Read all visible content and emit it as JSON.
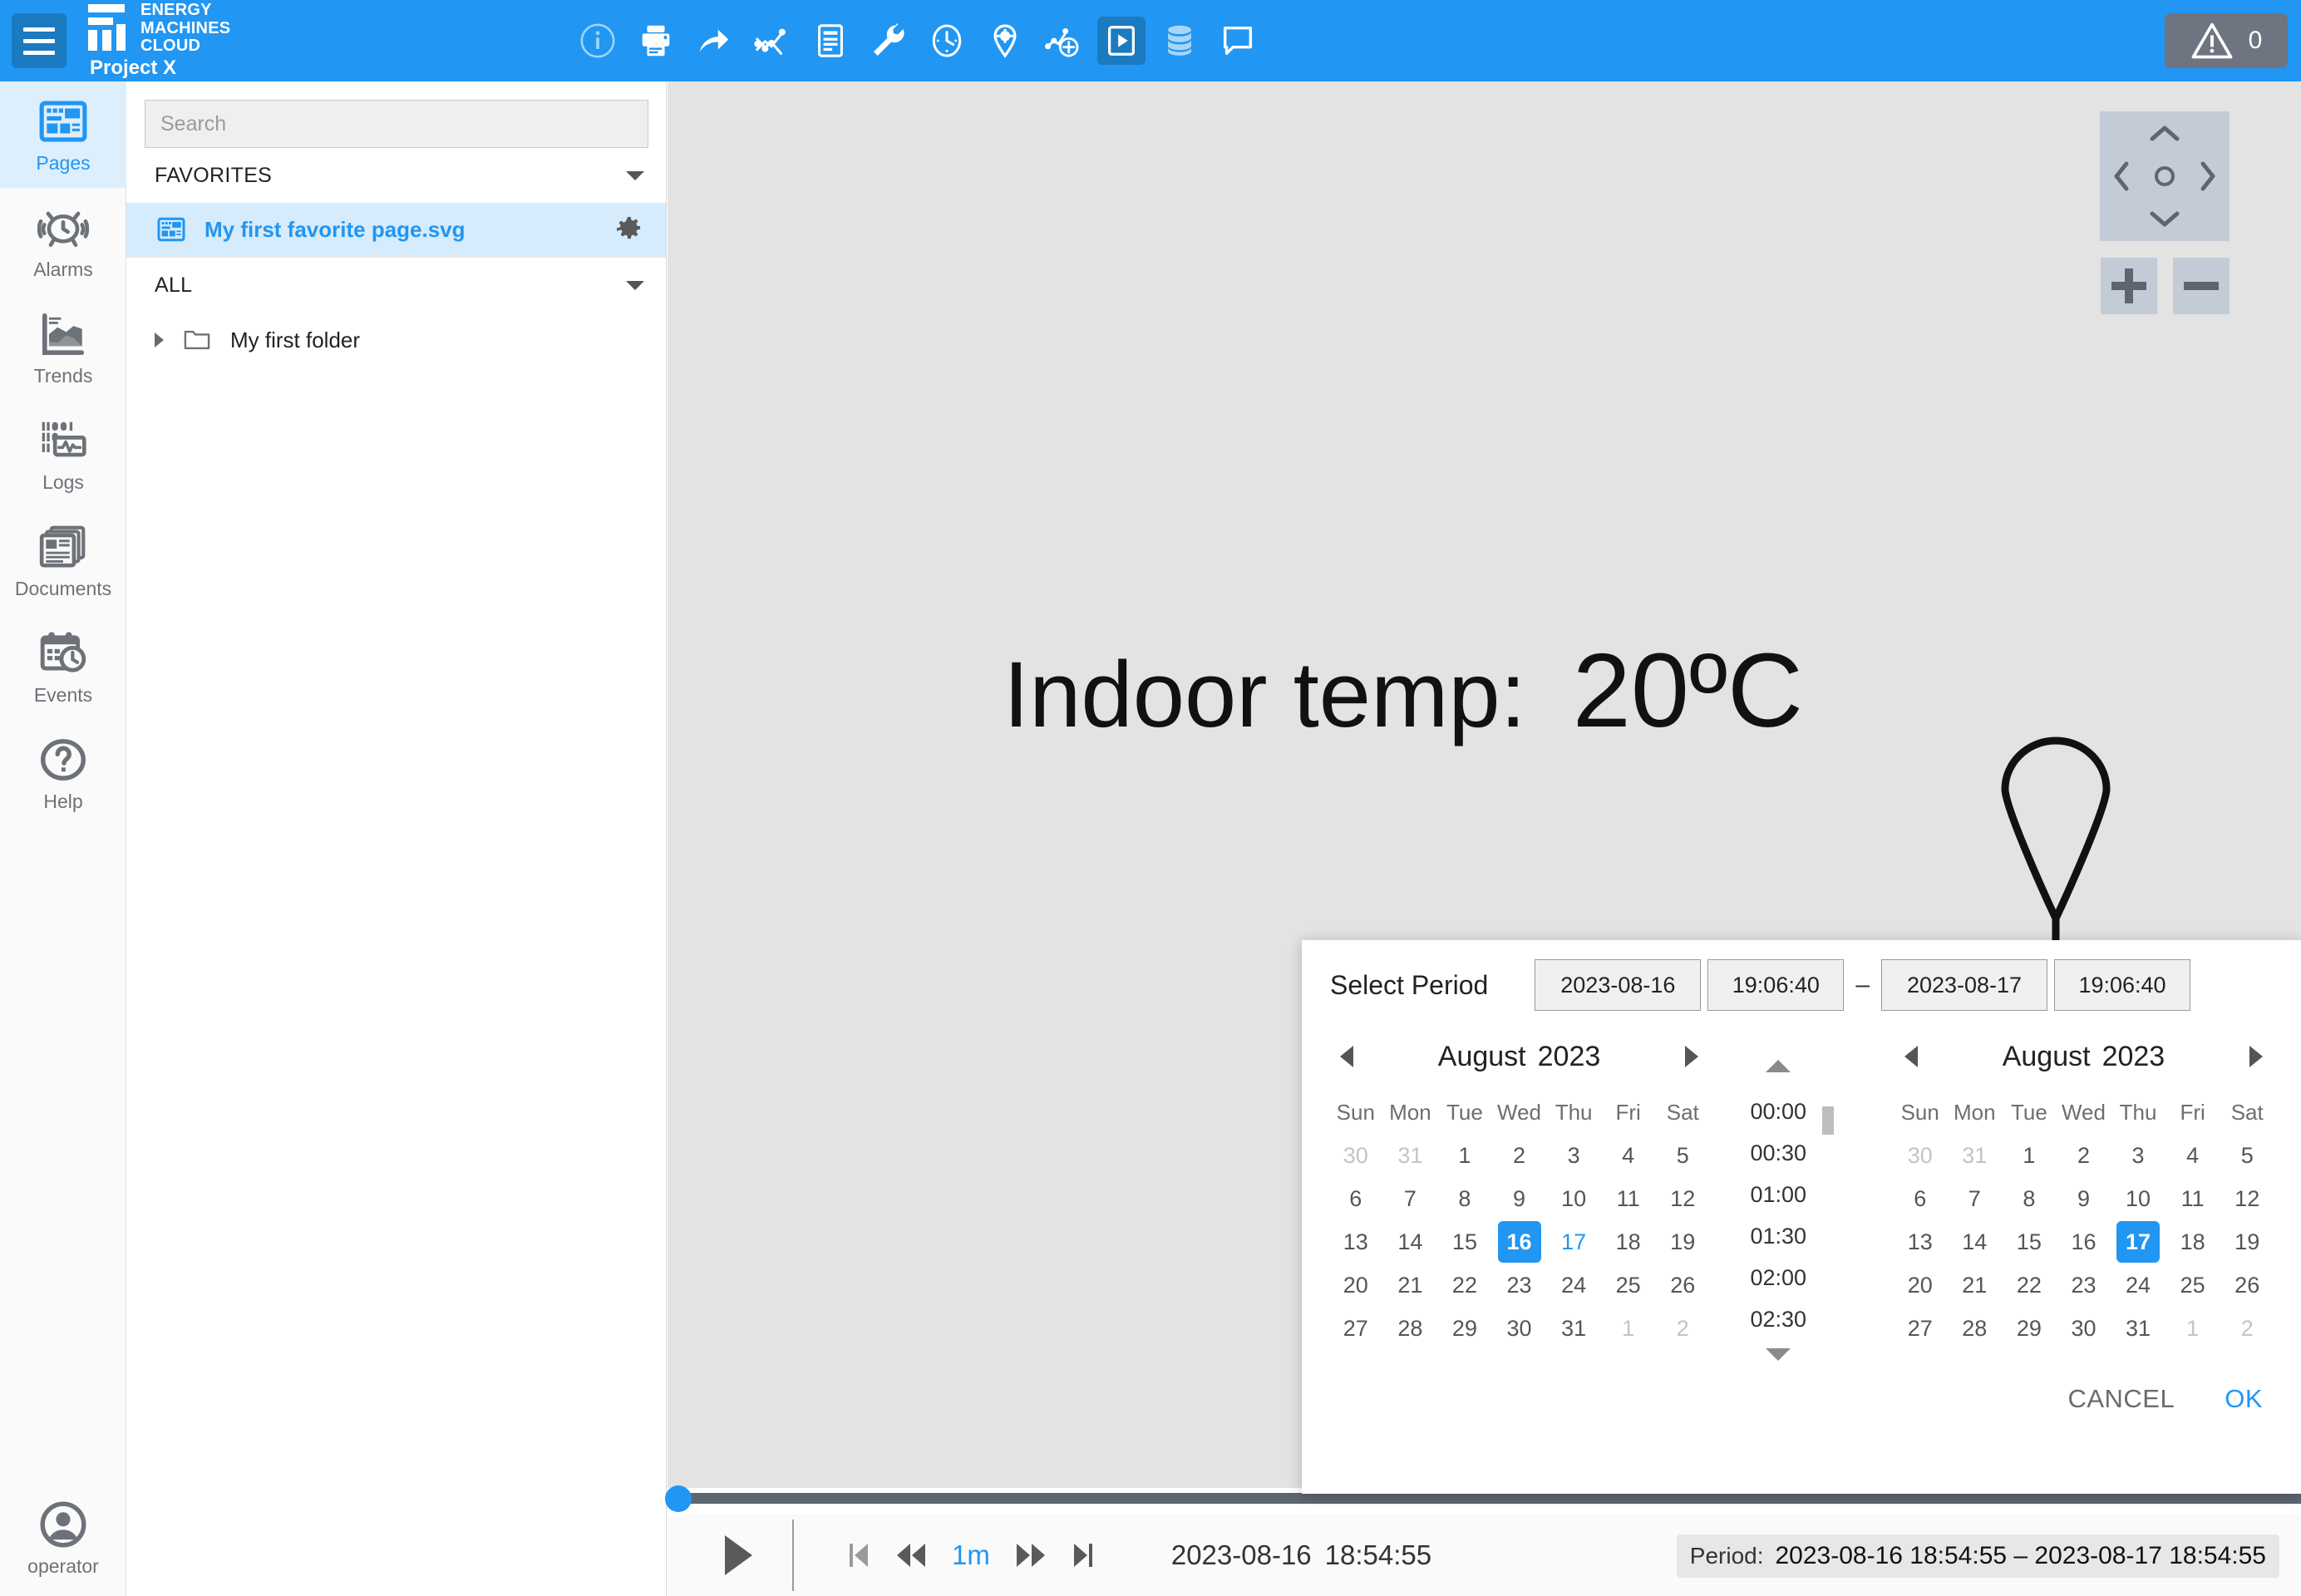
{
  "header": {
    "brand_lines": [
      "ENERGY",
      "MACHINES",
      "CLOUD"
    ],
    "project": "Project X",
    "menu_icon": "hamburger-icon",
    "toolbar": [
      {
        "name": "info-icon",
        "label": "Info",
        "active": false
      },
      {
        "name": "print-icon",
        "label": "Print",
        "active": false
      },
      {
        "name": "share-icon",
        "label": "Share",
        "active": false
      },
      {
        "name": "trend-icon",
        "label": "Trend",
        "active": false
      },
      {
        "name": "report-icon",
        "label": "Report",
        "active": false
      },
      {
        "name": "wrench-icon",
        "label": "Service",
        "active": false
      },
      {
        "name": "clock-icon",
        "label": "Schedule",
        "active": false
      },
      {
        "name": "settings-point-icon",
        "label": "Settings",
        "active": false
      },
      {
        "name": "add-point-icon",
        "label": "Add point",
        "active": false
      },
      {
        "name": "play-panel-icon",
        "label": "Playback",
        "active": true
      },
      {
        "name": "database-icon",
        "label": "Database",
        "active": false
      },
      {
        "name": "comment-icon",
        "label": "Comments",
        "active": false
      }
    ],
    "alarm": {
      "icon": "warning-triangle-icon",
      "count": "0"
    }
  },
  "sidebar": {
    "items": [
      {
        "label": "Pages",
        "icon": "pages-icon",
        "active": true
      },
      {
        "label": "Alarms",
        "icon": "alarm-clock-icon",
        "active": false
      },
      {
        "label": "Trends",
        "icon": "trends-chart-icon",
        "active": false
      },
      {
        "label": "Logs",
        "icon": "logs-icon",
        "active": false
      },
      {
        "label": "Documents",
        "icon": "documents-icon",
        "active": false
      },
      {
        "label": "Events",
        "icon": "events-calendar-icon",
        "active": false
      },
      {
        "label": "Help",
        "icon": "help-question-icon",
        "active": false
      }
    ],
    "user": {
      "label": "operator",
      "icon": "account-circle-icon"
    }
  },
  "tree": {
    "search_placeholder": "Search",
    "search_value": "",
    "favorites_header": "FAVORITES",
    "favorite_item": {
      "label": "My first favorite page.svg",
      "icon": "page-icon",
      "settings_icon": "gear-icon"
    },
    "all_header": "ALL",
    "folder_item": {
      "label": "My first folder",
      "icon": "folder-icon"
    }
  },
  "canvas": {
    "label": "Indoor temp:",
    "value": "20ºC",
    "symbol": "temperature-sensor-pin",
    "pan_control": {
      "up": "chevron-up-icon",
      "down": "chevron-down-icon",
      "left": "chevron-left-icon",
      "right": "chevron-right-icon",
      "center": "circle-reset-icon"
    },
    "zoom_in": "plus-icon",
    "zoom_out": "minus-icon"
  },
  "dialog": {
    "title": "Select Period",
    "start_date": "2023-08-16",
    "start_time": "19:06:40",
    "separator": "–",
    "end_date": "2023-08-17",
    "end_time": "19:06:40",
    "cancel_label": "CANCEL",
    "ok_label": "OK",
    "time_list": [
      "00:00",
      "00:30",
      "01:00",
      "01:30",
      "02:00",
      "02:30"
    ],
    "left_calendar": {
      "month": "August",
      "year": "2023",
      "dow": [
        "Sun",
        "Mon",
        "Tue",
        "Wed",
        "Thu",
        "Fri",
        "Sat"
      ],
      "weeks": [
        [
          {
            "d": "30",
            "s": "muted"
          },
          {
            "d": "31",
            "s": "muted"
          },
          {
            "d": "1",
            "s": ""
          },
          {
            "d": "2",
            "s": ""
          },
          {
            "d": "3",
            "s": ""
          },
          {
            "d": "4",
            "s": ""
          },
          {
            "d": "5",
            "s": ""
          }
        ],
        [
          {
            "d": "6",
            "s": ""
          },
          {
            "d": "7",
            "s": ""
          },
          {
            "d": "8",
            "s": ""
          },
          {
            "d": "9",
            "s": ""
          },
          {
            "d": "10",
            "s": ""
          },
          {
            "d": "11",
            "s": ""
          },
          {
            "d": "12",
            "s": ""
          }
        ],
        [
          {
            "d": "13",
            "s": ""
          },
          {
            "d": "14",
            "s": ""
          },
          {
            "d": "15",
            "s": ""
          },
          {
            "d": "16",
            "s": "sel"
          },
          {
            "d": "17",
            "s": "hl"
          },
          {
            "d": "18",
            "s": ""
          },
          {
            "d": "19",
            "s": ""
          }
        ],
        [
          {
            "d": "20",
            "s": ""
          },
          {
            "d": "21",
            "s": ""
          },
          {
            "d": "22",
            "s": ""
          },
          {
            "d": "23",
            "s": ""
          },
          {
            "d": "24",
            "s": ""
          },
          {
            "d": "25",
            "s": ""
          },
          {
            "d": "26",
            "s": ""
          }
        ],
        [
          {
            "d": "27",
            "s": ""
          },
          {
            "d": "28",
            "s": ""
          },
          {
            "d": "29",
            "s": ""
          },
          {
            "d": "30",
            "s": ""
          },
          {
            "d": "31",
            "s": ""
          },
          {
            "d": "1",
            "s": "muted"
          },
          {
            "d": "2",
            "s": "muted"
          }
        ]
      ]
    },
    "right_calendar": {
      "month": "August",
      "year": "2023",
      "dow": [
        "Sun",
        "Mon",
        "Tue",
        "Wed",
        "Thu",
        "Fri",
        "Sat"
      ],
      "weeks": [
        [
          {
            "d": "30",
            "s": "muted"
          },
          {
            "d": "31",
            "s": "muted"
          },
          {
            "d": "1",
            "s": ""
          },
          {
            "d": "2",
            "s": ""
          },
          {
            "d": "3",
            "s": ""
          },
          {
            "d": "4",
            "s": ""
          },
          {
            "d": "5",
            "s": ""
          }
        ],
        [
          {
            "d": "6",
            "s": ""
          },
          {
            "d": "7",
            "s": ""
          },
          {
            "d": "8",
            "s": ""
          },
          {
            "d": "9",
            "s": ""
          },
          {
            "d": "10",
            "s": ""
          },
          {
            "d": "11",
            "s": ""
          },
          {
            "d": "12",
            "s": ""
          }
        ],
        [
          {
            "d": "13",
            "s": ""
          },
          {
            "d": "14",
            "s": ""
          },
          {
            "d": "15",
            "s": ""
          },
          {
            "d": "16",
            "s": ""
          },
          {
            "d": "17",
            "s": "sel"
          },
          {
            "d": "18",
            "s": ""
          },
          {
            "d": "19",
            "s": ""
          }
        ],
        [
          {
            "d": "20",
            "s": ""
          },
          {
            "d": "21",
            "s": ""
          },
          {
            "d": "22",
            "s": ""
          },
          {
            "d": "23",
            "s": ""
          },
          {
            "d": "24",
            "s": ""
          },
          {
            "d": "25",
            "s": ""
          },
          {
            "d": "26",
            "s": ""
          }
        ],
        [
          {
            "d": "27",
            "s": ""
          },
          {
            "d": "28",
            "s": ""
          },
          {
            "d": "29",
            "s": ""
          },
          {
            "d": "30",
            "s": ""
          },
          {
            "d": "31",
            "s": ""
          },
          {
            "d": "1",
            "s": "muted"
          },
          {
            "d": "2",
            "s": "muted"
          }
        ]
      ]
    }
  },
  "player": {
    "play_icon": "play-icon",
    "skip_start_icon": "skip-to-start-icon",
    "rewind_icon": "rewind-icon",
    "step_label": "1m",
    "forward_icon": "fast-forward-icon",
    "skip_end_icon": "skip-to-end-icon",
    "current_date": "2023-08-16",
    "current_time": "18:54:55",
    "period_label": "Period:",
    "period_value": "2023-08-16 18:54:55 – 2023-08-17 18:54:55"
  },
  "colors": {
    "brand_blue": "#2196f3",
    "toolbar_active": "#1c7ac0",
    "canvas_bg": "#e3e3e3",
    "alarm_chip": "#6e7580"
  }
}
